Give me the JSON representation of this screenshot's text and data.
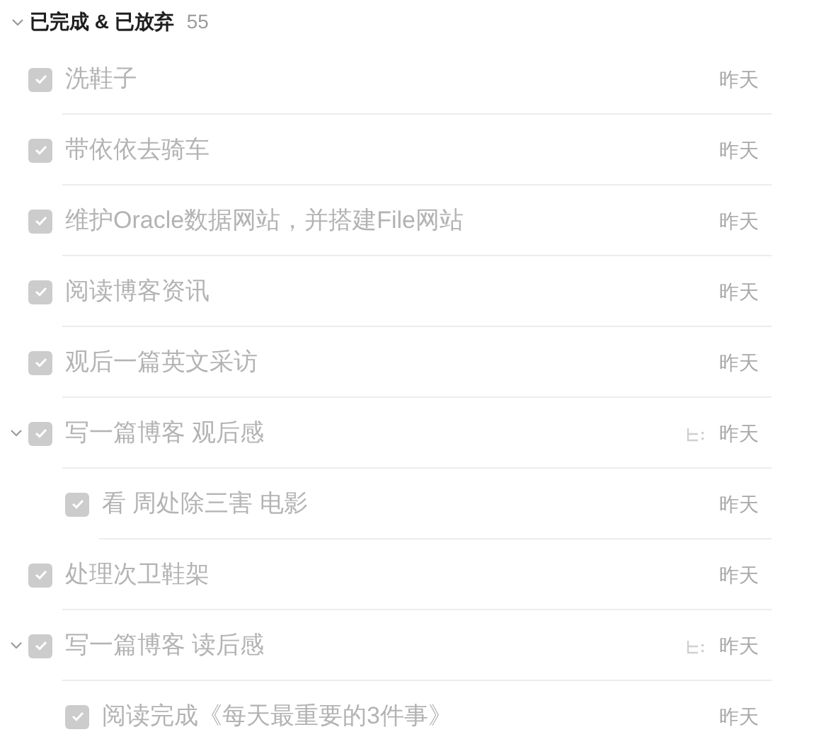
{
  "section": {
    "title": "已完成 & 已放弃",
    "count": "55",
    "expanded": true
  },
  "tasks": [
    {
      "title": "洗鞋子",
      "date": "昨天",
      "checked": true
    },
    {
      "title": "带依依去骑车",
      "date": "昨天",
      "checked": true
    },
    {
      "title": "维护Oracle数据网站，并搭建File网站",
      "date": "昨天",
      "checked": true
    },
    {
      "title": "阅读博客资讯",
      "date": "昨天",
      "checked": true
    },
    {
      "title": "观后一篇英文采访",
      "date": "昨天",
      "checked": true
    },
    {
      "title": "写一篇博客 观后感",
      "date": "昨天",
      "checked": true,
      "expanded": true,
      "children": [
        {
          "title": "看 周处除三害 电影",
          "date": "昨天",
          "checked": true
        }
      ]
    },
    {
      "title": "处理次卫鞋架",
      "date": "昨天",
      "checked": true
    },
    {
      "title": "写一篇博客 读后感",
      "date": "昨天",
      "checked": true,
      "expanded": true,
      "children": [
        {
          "title": "阅读完成《每天最重要的3件事》",
          "date": "昨天",
          "checked": true
        }
      ]
    }
  ]
}
